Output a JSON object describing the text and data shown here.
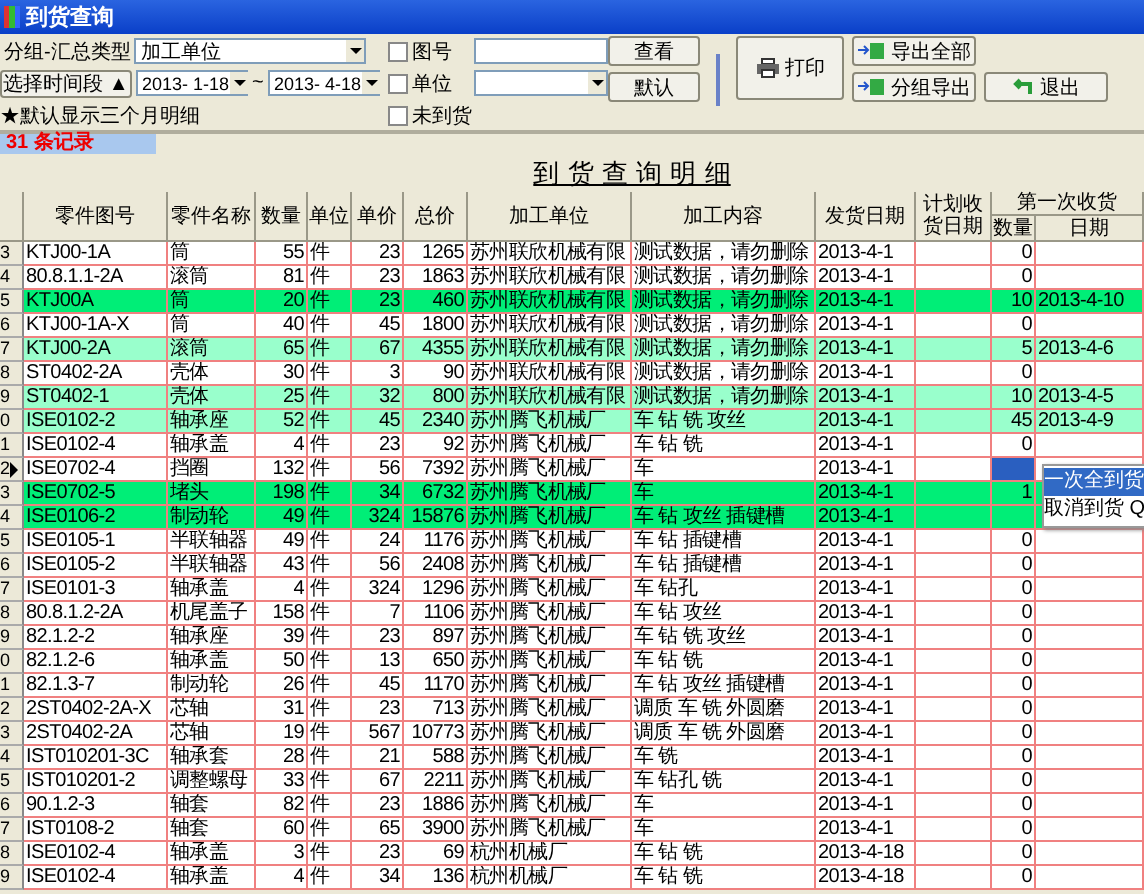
{
  "window": {
    "title": "到货查询"
  },
  "filters": {
    "group_label": "分组-汇总类型",
    "group_value": "加工单位",
    "period_button": "选择时间段 ▲",
    "date_from": "2013- 1-18",
    "date_sep": "~",
    "date_to": "2013- 4-18",
    "note": "★默认显示三个月明细",
    "checks": [
      {
        "label": "图号",
        "checked": false,
        "kind": "input"
      },
      {
        "label": "单位",
        "checked": false,
        "kind": "select"
      },
      {
        "label": "未到货",
        "checked": false,
        "kind": "plain"
      }
    ]
  },
  "buttons": {
    "view": "查看",
    "default": "默认",
    "print": "打印",
    "export_all": "导出全部",
    "export_group": "分组导出",
    "exit": "退出"
  },
  "record_count": "31 条记录",
  "report_title": "到 货 查 询 明 细",
  "columns": [
    {
      "label": "零件图号"
    },
    {
      "label": "零件名称"
    },
    {
      "label": "数量"
    },
    {
      "label": "单位"
    },
    {
      "label": "单价"
    },
    {
      "label": "总价"
    },
    {
      "label": "加工单位"
    },
    {
      "label": "加工内容"
    },
    {
      "label": "发货日期"
    },
    {
      "label": "计划收货日期"
    },
    {
      "label": "第一次收货",
      "children": [
        {
          "label": "数量"
        },
        {
          "label": "日期"
        }
      ]
    }
  ],
  "rows": [
    {
      "n": "3",
      "current": false,
      "color": "#ffffff",
      "qty_selected": false,
      "part_no": "KTJ00-1A",
      "part_name": "筒",
      "quantity": "55",
      "unit": "件",
      "unit_price": "23",
      "total": "1265",
      "vendor": "苏州联欣机械有限",
      "process": "测试数据，请勿删除",
      "ship_date": "2013-4-1",
      "received_qty": "0"
    },
    {
      "n": "4",
      "current": false,
      "color": "#ffffff",
      "qty_selected": false,
      "part_no": "80.8.1.1-2A",
      "part_name": "滚筒",
      "quantity": "81",
      "unit": "件",
      "unit_price": "23",
      "total": "1863",
      "vendor": "苏州联欣机械有限",
      "process": "测试数据，请勿删除",
      "ship_date": "2013-4-1",
      "received_qty": "0"
    },
    {
      "n": "5",
      "current": false,
      "color": "#00ee77",
      "qty_selected": false,
      "part_no": "KTJ00A",
      "part_name": "筒",
      "quantity": "20",
      "unit": "件",
      "unit_price": "23",
      "total": "460",
      "vendor": "苏州联欣机械有限",
      "process": "测试数据，请勿删除",
      "ship_date": "2013-4-1",
      "received_qty": "10",
      "received_date": "2013-4-10"
    },
    {
      "n": "6",
      "current": false,
      "color": "#ffffff",
      "qty_selected": false,
      "part_no": "KTJ00-1A-X",
      "part_name": "筒",
      "quantity": "40",
      "unit": "件",
      "unit_price": "45",
      "total": "1800",
      "vendor": "苏州联欣机械有限",
      "process": "测试数据，请勿删除",
      "ship_date": "2013-4-1",
      "received_qty": "0"
    },
    {
      "n": "7",
      "current": false,
      "color": "#99ffcc",
      "qty_selected": false,
      "part_no": "KTJ00-2A",
      "part_name": "滚筒",
      "quantity": "65",
      "unit": "件",
      "unit_price": "67",
      "total": "4355",
      "vendor": "苏州联欣机械有限",
      "process": "测试数据，请勿删除",
      "ship_date": "2013-4-1",
      "received_qty": "5",
      "received_date": "2013-4-6"
    },
    {
      "n": "8",
      "current": false,
      "color": "#ffffff",
      "qty_selected": false,
      "part_no": "ST0402-2A",
      "part_name": "壳体",
      "quantity": "30",
      "unit": "件",
      "unit_price": "3",
      "total": "90",
      "vendor": "苏州联欣机械有限",
      "process": "测试数据，请勿删除",
      "ship_date": "2013-4-1",
      "received_qty": "0"
    },
    {
      "n": "9",
      "current": false,
      "color": "#99ffcc",
      "qty_selected": false,
      "part_no": "ST0402-1",
      "part_name": "壳体",
      "quantity": "25",
      "unit": "件",
      "unit_price": "32",
      "total": "800",
      "vendor": "苏州联欣机械有限",
      "process": "测试数据，请勿删除",
      "ship_date": "2013-4-1",
      "received_qty": "10",
      "received_date": "2013-4-5"
    },
    {
      "n": "0",
      "current": false,
      "color": "#99ffcc",
      "qty_selected": false,
      "part_no": "ISE0102-2",
      "part_name": "轴承座",
      "quantity": "52",
      "unit": "件",
      "unit_price": "45",
      "total": "2340",
      "vendor": "苏州腾飞机械厂",
      "process": "车 钻 铣 攻丝",
      "ship_date": "2013-4-1",
      "received_qty": "45",
      "received_date": "2013-4-9"
    },
    {
      "n": "1",
      "current": false,
      "color": "#ffffff",
      "qty_selected": false,
      "part_no": "ISE0102-4",
      "part_name": "轴承盖",
      "quantity": "4",
      "unit": "件",
      "unit_price": "23",
      "total": "92",
      "vendor": "苏州腾飞机械厂",
      "process": "车 钻 铣",
      "ship_date": "2013-4-1",
      "received_qty": "0"
    },
    {
      "n": "2",
      "current": true,
      "color": "#ffffff",
      "qty_selected": true,
      "part_no": "ISE0702-4",
      "part_name": "挡圈",
      "quantity": "132",
      "unit": "件",
      "unit_price": "56",
      "total": "7392",
      "vendor": "苏州腾飞机械厂",
      "process": "车",
      "ship_date": "2013-4-1"
    },
    {
      "n": "3",
      "current": false,
      "color": "#00ee77",
      "qty_selected": false,
      "part_no": "ISE0702-5",
      "part_name": "堵头",
      "quantity": "198",
      "unit": "件",
      "unit_price": "34",
      "total": "6732",
      "vendor": "苏州腾飞机械厂",
      "process": "车",
      "ship_date": "2013-4-1",
      "received_qty": "1"
    },
    {
      "n": "4",
      "current": false,
      "color": "#00ee77",
      "qty_selected": false,
      "part_no": "ISE0106-2",
      "part_name": "制动轮",
      "quantity": "49",
      "unit": "件",
      "unit_price": "324",
      "total": "15876",
      "vendor": "苏州腾飞机械厂",
      "process": "车 钻 攻丝 插键槽",
      "ship_date": "2013-4-1"
    },
    {
      "n": "5",
      "current": false,
      "color": "#ffffff",
      "qty_selected": false,
      "part_no": "ISE0105-1",
      "part_name": "半联轴器",
      "quantity": "49",
      "unit": "件",
      "unit_price": "24",
      "total": "1176",
      "vendor": "苏州腾飞机械厂",
      "process": "车 钻 插键槽",
      "ship_date": "2013-4-1",
      "received_qty": "0"
    },
    {
      "n": "6",
      "current": false,
      "color": "#ffffff",
      "qty_selected": false,
      "part_no": "ISE0105-2",
      "part_name": "半联轴器",
      "quantity": "43",
      "unit": "件",
      "unit_price": "56",
      "total": "2408",
      "vendor": "苏州腾飞机械厂",
      "process": "车 钻 插键槽",
      "ship_date": "2013-4-1",
      "received_qty": "0"
    },
    {
      "n": "7",
      "current": false,
      "color": "#ffffff",
      "qty_selected": false,
      "part_no": "ISE0101-3",
      "part_name": "轴承盖",
      "quantity": "4",
      "unit": "件",
      "unit_price": "324",
      "total": "1296",
      "vendor": "苏州腾飞机械厂",
      "process": "车 钻孔",
      "ship_date": "2013-4-1",
      "received_qty": "0"
    },
    {
      "n": "8",
      "current": false,
      "color": "#ffffff",
      "qty_selected": false,
      "part_no": "80.8.1.2-2A",
      "part_name": "机尾盖子",
      "quantity": "158",
      "unit": "件",
      "unit_price": "7",
      "total": "1106",
      "vendor": "苏州腾飞机械厂",
      "process": "车 钻 攻丝",
      "ship_date": "2013-4-1",
      "received_qty": "0"
    },
    {
      "n": "9",
      "current": false,
      "color": "#ffffff",
      "qty_selected": false,
      "part_no": "82.1.2-2",
      "part_name": "轴承座",
      "quantity": "39",
      "unit": "件",
      "unit_price": "23",
      "total": "897",
      "vendor": "苏州腾飞机械厂",
      "process": "车 钻 铣 攻丝",
      "ship_date": "2013-4-1",
      "received_qty": "0"
    },
    {
      "n": "0",
      "current": false,
      "color": "#ffffff",
      "qty_selected": false,
      "part_no": "82.1.2-6",
      "part_name": "轴承盖",
      "quantity": "50",
      "unit": "件",
      "unit_price": "13",
      "total": "650",
      "vendor": "苏州腾飞机械厂",
      "process": "车 钻 铣",
      "ship_date": "2013-4-1",
      "received_qty": "0"
    },
    {
      "n": "1",
      "current": false,
      "color": "#ffffff",
      "qty_selected": false,
      "part_no": "82.1.3-7",
      "part_name": "制动轮",
      "quantity": "26",
      "unit": "件",
      "unit_price": "45",
      "total": "1170",
      "vendor": "苏州腾飞机械厂",
      "process": "车 钻 攻丝 插键槽",
      "ship_date": "2013-4-1",
      "received_qty": "0"
    },
    {
      "n": "2",
      "current": false,
      "color": "#ffffff",
      "qty_selected": false,
      "part_no": "2ST0402-2A-X",
      "part_name": "芯轴",
      "quantity": "31",
      "unit": "件",
      "unit_price": "23",
      "total": "713",
      "vendor": "苏州腾飞机械厂",
      "process": "调质 车 铣 外圆磨",
      "ship_date": "2013-4-1",
      "received_qty": "0"
    },
    {
      "n": "3",
      "current": false,
      "color": "#ffffff",
      "qty_selected": false,
      "part_no": "2ST0402-2A",
      "part_name": "芯轴",
      "quantity": "19",
      "unit": "件",
      "unit_price": "567",
      "total": "10773",
      "vendor": "苏州腾飞机械厂",
      "process": "调质 车 铣 外圆磨",
      "ship_date": "2013-4-1",
      "received_qty": "0"
    },
    {
      "n": "4",
      "current": false,
      "color": "#ffffff",
      "qty_selected": false,
      "part_no": "IST010201-3C",
      "part_name": "轴承套",
      "quantity": "28",
      "unit": "件",
      "unit_price": "21",
      "total": "588",
      "vendor": "苏州腾飞机械厂",
      "process": "车 铣",
      "ship_date": "2013-4-1",
      "received_qty": "0"
    },
    {
      "n": "5",
      "current": false,
      "color": "#ffffff",
      "qty_selected": false,
      "part_no": "IST010201-2",
      "part_name": "调整螺母",
      "quantity": "33",
      "unit": "件",
      "unit_price": "67",
      "total": "2211",
      "vendor": "苏州腾飞机械厂",
      "process": "车 钻孔 铣",
      "ship_date": "2013-4-1",
      "received_qty": "0"
    },
    {
      "n": "6",
      "current": false,
      "color": "#ffffff",
      "qty_selected": false,
      "part_no": "90.1.2-3",
      "part_name": "轴套",
      "quantity": "82",
      "unit": "件",
      "unit_price": "23",
      "total": "1886",
      "vendor": "苏州腾飞机械厂",
      "process": "车",
      "ship_date": "2013-4-1",
      "received_qty": "0"
    },
    {
      "n": "7",
      "current": false,
      "color": "#ffffff",
      "qty_selected": false,
      "part_no": "IST0108-2",
      "part_name": "轴套",
      "quantity": "60",
      "unit": "件",
      "unit_price": "65",
      "total": "3900",
      "vendor": "苏州腾飞机械厂",
      "process": "车",
      "ship_date": "2013-4-1",
      "received_qty": "0"
    },
    {
      "n": "8",
      "current": false,
      "color": "#ffffff",
      "qty_selected": false,
      "part_no": "ISE0102-4",
      "part_name": "轴承盖",
      "quantity": "3",
      "unit": "件",
      "unit_price": "23",
      "total": "69",
      "vendor": "杭州机械厂",
      "process": "车 钻 铣",
      "ship_date": "2013-4-18",
      "received_qty": "0"
    },
    {
      "n": "9",
      "current": false,
      "color": "#ffffff",
      "qty_selected": false,
      "part_no": "ISE0102-4",
      "part_name": "轴承盖",
      "quantity": "4",
      "unit": "件",
      "unit_price": "34",
      "total": "136",
      "vendor": "杭州机械厂",
      "process": "车 钻 铣",
      "ship_date": "2013-4-18",
      "received_qty": "0"
    }
  ],
  "context_menu": {
    "items": [
      {
        "label": "一次全到货",
        "selected": true
      },
      {
        "label": "取消到货 Q",
        "selected": false
      }
    ]
  }
}
